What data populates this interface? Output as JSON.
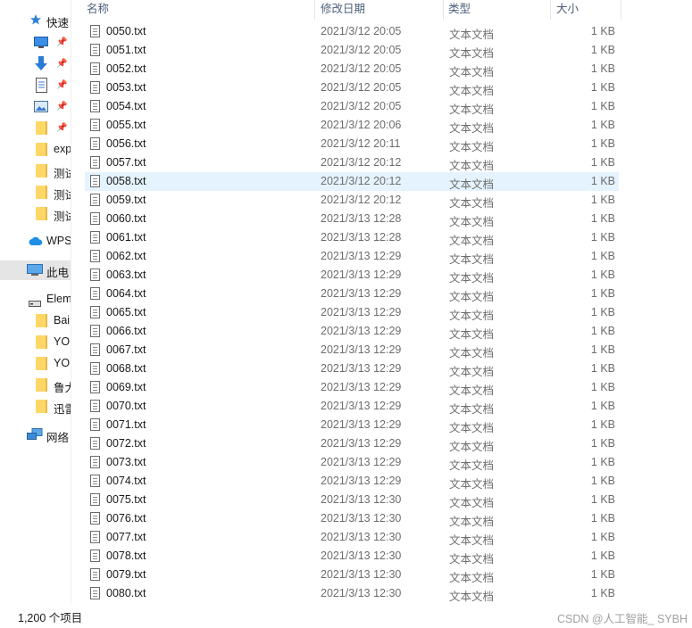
{
  "nav": {
    "items": [
      {
        "label": "快速",
        "icon": "star-icon",
        "pinned": false
      },
      {
        "label": "",
        "icon": "desktop-icon",
        "pinned": true
      },
      {
        "label": "",
        "icon": "download-arrow-icon",
        "pinned": true
      },
      {
        "label": "",
        "icon": "document-icon",
        "pinned": true
      },
      {
        "label": "",
        "icon": "picture-icon",
        "pinned": true
      },
      {
        "label": "",
        "icon": "folder-icon",
        "pinned": true
      },
      {
        "label": "exp",
        "icon": "folder-icon",
        "pinned": false
      },
      {
        "label": "测试",
        "icon": "folder-icon",
        "pinned": false
      },
      {
        "label": "测试",
        "icon": "folder-icon",
        "pinned": false
      },
      {
        "label": "测试",
        "icon": "folder-icon",
        "pinned": false
      },
      {
        "label": "WPS",
        "icon": "cloud-icon",
        "pinned": false
      },
      {
        "label": "此电",
        "icon": "computer-icon",
        "pinned": false
      },
      {
        "label": "Elem",
        "icon": "drive-icon",
        "pinned": false
      },
      {
        "label": "Bai",
        "icon": "folder-icon",
        "pinned": false
      },
      {
        "label": "YO",
        "icon": "folder-icon",
        "pinned": false
      },
      {
        "label": "YO",
        "icon": "folder-icon",
        "pinned": false
      },
      {
        "label": "鲁大",
        "icon": "folder-icon",
        "pinned": false
      },
      {
        "label": "迅雷",
        "icon": "folder-icon",
        "pinned": false
      },
      {
        "label": "网络",
        "icon": "network-icon",
        "pinned": false
      }
    ]
  },
  "columns": {
    "name": "名称",
    "date": "修改日期",
    "type": "类型",
    "size": "大小"
  },
  "files": [
    {
      "name": "0050.txt",
      "date": "2021/3/12 20:05",
      "type": "文本文档",
      "size": "1 KB"
    },
    {
      "name": "0051.txt",
      "date": "2021/3/12 20:05",
      "type": "文本文档",
      "size": "1 KB"
    },
    {
      "name": "0052.txt",
      "date": "2021/3/12 20:05",
      "type": "文本文档",
      "size": "1 KB"
    },
    {
      "name": "0053.txt",
      "date": "2021/3/12 20:05",
      "type": "文本文档",
      "size": "1 KB"
    },
    {
      "name": "0054.txt",
      "date": "2021/3/12 20:05",
      "type": "文本文档",
      "size": "1 KB"
    },
    {
      "name": "0055.txt",
      "date": "2021/3/12 20:06",
      "type": "文本文档",
      "size": "1 KB"
    },
    {
      "name": "0056.txt",
      "date": "2021/3/12 20:11",
      "type": "文本文档",
      "size": "1 KB"
    },
    {
      "name": "0057.txt",
      "date": "2021/3/12 20:12",
      "type": "文本文档",
      "size": "1 KB"
    },
    {
      "name": "0058.txt",
      "date": "2021/3/12 20:12",
      "type": "文本文档",
      "size": "1 KB"
    },
    {
      "name": "0059.txt",
      "date": "2021/3/12 20:12",
      "type": "文本文档",
      "size": "1 KB"
    },
    {
      "name": "0060.txt",
      "date": "2021/3/13 12:28",
      "type": "文本文档",
      "size": "1 KB"
    },
    {
      "name": "0061.txt",
      "date": "2021/3/13 12:28",
      "type": "文本文档",
      "size": "1 KB"
    },
    {
      "name": "0062.txt",
      "date": "2021/3/13 12:29",
      "type": "文本文档",
      "size": "1 KB"
    },
    {
      "name": "0063.txt",
      "date": "2021/3/13 12:29",
      "type": "文本文档",
      "size": "1 KB"
    },
    {
      "name": "0064.txt",
      "date": "2021/3/13 12:29",
      "type": "文本文档",
      "size": "1 KB"
    },
    {
      "name": "0065.txt",
      "date": "2021/3/13 12:29",
      "type": "文本文档",
      "size": "1 KB"
    },
    {
      "name": "0066.txt",
      "date": "2021/3/13 12:29",
      "type": "文本文档",
      "size": "1 KB"
    },
    {
      "name": "0067.txt",
      "date": "2021/3/13 12:29",
      "type": "文本文档",
      "size": "1 KB"
    },
    {
      "name": "0068.txt",
      "date": "2021/3/13 12:29",
      "type": "文本文档",
      "size": "1 KB"
    },
    {
      "name": "0069.txt",
      "date": "2021/3/13 12:29",
      "type": "文本文档",
      "size": "1 KB"
    },
    {
      "name": "0070.txt",
      "date": "2021/3/13 12:29",
      "type": "文本文档",
      "size": "1 KB"
    },
    {
      "name": "0071.txt",
      "date": "2021/3/13 12:29",
      "type": "文本文档",
      "size": "1 KB"
    },
    {
      "name": "0072.txt",
      "date": "2021/3/13 12:29",
      "type": "文本文档",
      "size": "1 KB"
    },
    {
      "name": "0073.txt",
      "date": "2021/3/13 12:29",
      "type": "文本文档",
      "size": "1 KB"
    },
    {
      "name": "0074.txt",
      "date": "2021/3/13 12:29",
      "type": "文本文档",
      "size": "1 KB"
    },
    {
      "name": "0075.txt",
      "date": "2021/3/13 12:30",
      "type": "文本文档",
      "size": "1 KB"
    },
    {
      "name": "0076.txt",
      "date": "2021/3/13 12:30",
      "type": "文本文档",
      "size": "1 KB"
    },
    {
      "name": "0077.txt",
      "date": "2021/3/13 12:30",
      "type": "文本文档",
      "size": "1 KB"
    },
    {
      "name": "0078.txt",
      "date": "2021/3/13 12:30",
      "type": "文本文档",
      "size": "1 KB"
    },
    {
      "name": "0079.txt",
      "date": "2021/3/13 12:30",
      "type": "文本文档",
      "size": "1 KB"
    },
    {
      "name": "0080.txt",
      "date": "2021/3/13 12:30",
      "type": "文本文档",
      "size": "1 KB"
    }
  ],
  "hovered_file": "0058.txt",
  "status": {
    "item_count": "1,200 个项目",
    "watermark": "CSDN @人工智能_ SYBH"
  }
}
